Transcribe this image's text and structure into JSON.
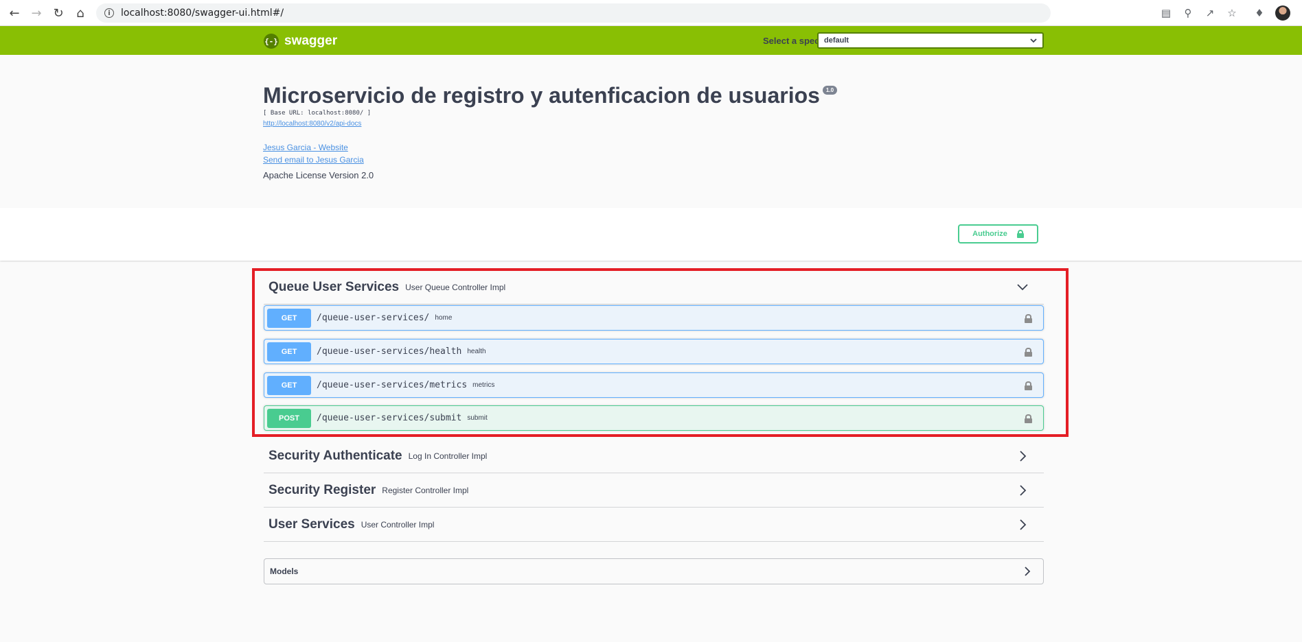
{
  "browser": {
    "url": "localhost:8080/swagger-ui.html#/",
    "info_icon": "i",
    "icons": [
      "back-icon",
      "forward-icon",
      "reload-icon",
      "home-icon",
      "translate-icon",
      "zoom-icon",
      "share-icon",
      "star-icon",
      "extensions-icon",
      "avatar"
    ]
  },
  "topbar": {
    "logo_text": "swagger",
    "logo_glyph": "{-}",
    "spec_label": "Select a spec",
    "spec_value": "default",
    "color": "#89bf04"
  },
  "info": {
    "title": "Microservicio de registro y autenficacion de usuarios",
    "version": "1.0",
    "base_url": "[ Base URL: localhost:8080/ ]",
    "api_docs_link": "http://localhost:8080/v2/api-docs",
    "website_link": "Jesus Garcia - Website",
    "email_link": "Send email to Jesus Garcia",
    "license": "Apache License Version 2.0"
  },
  "authorize": {
    "label": "Authorize"
  },
  "tags": [
    {
      "name": "Queue User Services",
      "description": "User Queue Controller Impl",
      "expanded": true,
      "operations": [
        {
          "method": "GET",
          "path": "/queue-user-services/",
          "summary": "home"
        },
        {
          "method": "GET",
          "path": "/queue-user-services/health",
          "summary": "health"
        },
        {
          "method": "GET",
          "path": "/queue-user-services/metrics",
          "summary": "metrics"
        },
        {
          "method": "POST",
          "path": "/queue-user-services/submit",
          "summary": "submit"
        }
      ]
    },
    {
      "name": "Security Authenticate",
      "description": "Log In Controller Impl",
      "expanded": false
    },
    {
      "name": "Security Register",
      "description": "Register Controller Impl",
      "expanded": false
    },
    {
      "name": "User Services",
      "description": "User Controller Impl",
      "expanded": false
    }
  ],
  "models": {
    "label": "Models"
  },
  "colors": {
    "get": "#61affe",
    "post": "#49cc90",
    "highlight": "#e41e26"
  }
}
